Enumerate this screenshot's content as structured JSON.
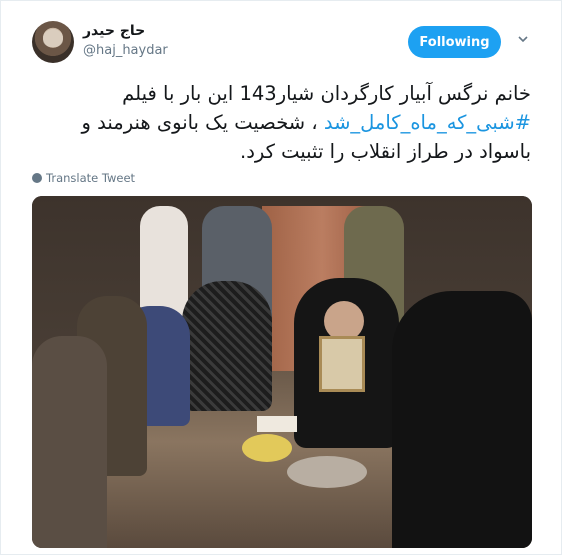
{
  "user": {
    "display_name": "حاج حیدر",
    "handle": "@haj_haydar",
    "avatar_icon": "user-avatar"
  },
  "follow": {
    "label": "Following",
    "color": "#1da1f2"
  },
  "menu": {
    "icon": "chevron-down-icon"
  },
  "tweet": {
    "line1": "خانم نرگس آبیار کارگردان شیار143 این بار با فیلم",
    "hashtag": "#شبی_که_ماه_کامل_شد",
    "line2_rest": " ، شخصیت یک بانوی هنرمند و",
    "line3": "باسواد در طراز انقلاب را تثبیت کرد."
  },
  "translate": {
    "label": "Translate Tweet",
    "icon": "globe-icon"
  },
  "colors": {
    "link": "#1b95e0",
    "muted": "#657786"
  }
}
